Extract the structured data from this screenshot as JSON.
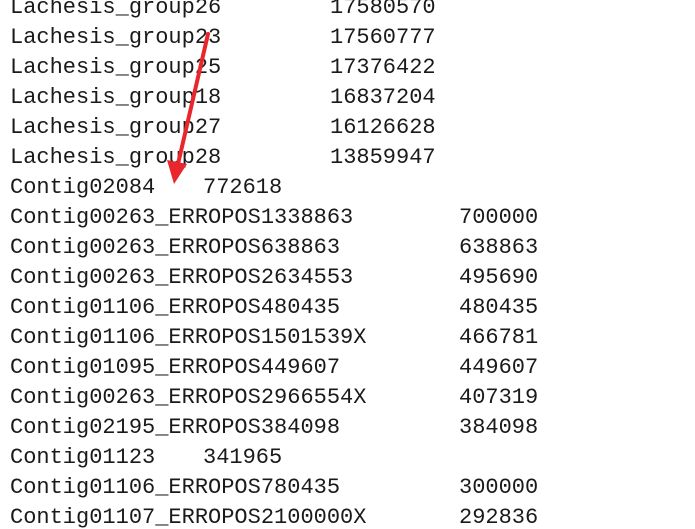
{
  "rows": [
    {
      "name": "Lachesis_group26",
      "value": "17580570",
      "kind": "lachesis"
    },
    {
      "name": "Lachesis_group23",
      "value": "17560777",
      "kind": "lachesis"
    },
    {
      "name": "Lachesis_group25",
      "value": "17376422",
      "kind": "lachesis"
    },
    {
      "name": "Lachesis_group18",
      "value": "16837204",
      "kind": "lachesis"
    },
    {
      "name": "Lachesis_group27",
      "value": "16126628",
      "kind": "lachesis"
    },
    {
      "name": "Lachesis_group28",
      "value": "13859947",
      "kind": "lachesis"
    },
    {
      "name": "Contig02084",
      "value": "772618",
      "kind": "short"
    },
    {
      "name": "Contig00263_ERROPOS1338863",
      "value": "700000",
      "kind": "contig"
    },
    {
      "name": "Contig00263_ERROPOS638863",
      "value": "638863",
      "kind": "contig"
    },
    {
      "name": "Contig00263_ERROPOS2634553",
      "value": "495690",
      "kind": "contig"
    },
    {
      "name": "Contig01106_ERROPOS480435",
      "value": "480435",
      "kind": "contig"
    },
    {
      "name": "Contig01106_ERROPOS1501539X",
      "value": "466781",
      "kind": "contig"
    },
    {
      "name": "Contig01095_ERROPOS449607",
      "value": "449607",
      "kind": "contig"
    },
    {
      "name": "Contig00263_ERROPOS2966554X",
      "value": "407319",
      "kind": "contig"
    },
    {
      "name": "Contig02195_ERROPOS384098",
      "value": "384098",
      "kind": "contig"
    },
    {
      "name": "Contig01123",
      "value": "341965",
      "kind": "short"
    },
    {
      "name": "Contig01106_ERROPOS780435",
      "value": "300000",
      "kind": "contig"
    },
    {
      "name": "Contig01107_ERROPOS2100000X",
      "value": "292836",
      "kind": "contig"
    }
  ],
  "annotation": {
    "color": "#e8262b",
    "icon": "red-arrow-icon"
  }
}
